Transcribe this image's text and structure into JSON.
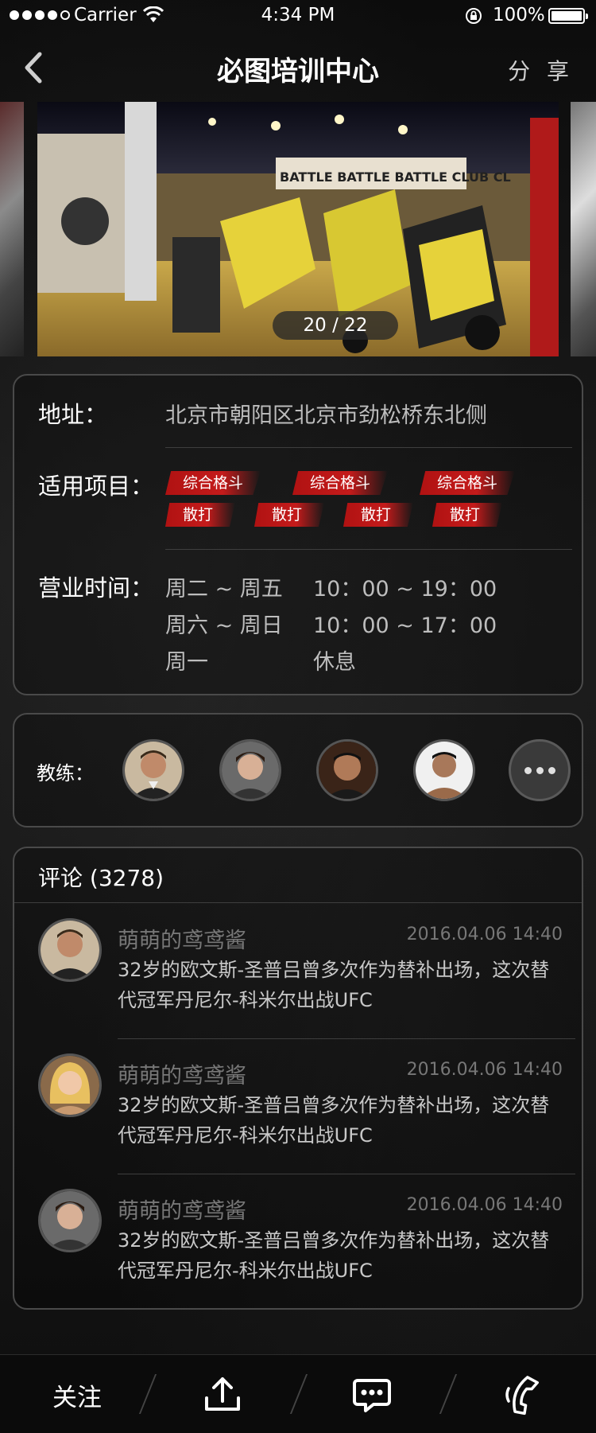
{
  "status_bar": {
    "carrier": "Carrier",
    "time": "4:34 PM",
    "battery_pct": "100%"
  },
  "nav": {
    "title": "必图培训中心",
    "share_label": "分 享"
  },
  "carousel": {
    "counter": "20 / 22",
    "sign_text": "BATTLE BATTLE BATTLE CLUB CL"
  },
  "info": {
    "address_label": "地址：",
    "address_value": "北京市朝阳区北京市劲松桥东北侧",
    "projects_label": "适用项目：",
    "project_tags_row1": [
      "综合格斗",
      "综合格斗",
      "综合格斗"
    ],
    "project_tags_row2": [
      "散打",
      "散打",
      "散打",
      "散打"
    ],
    "hours_label": "营业时间：",
    "hours": [
      {
        "days": "周二 ~ 周五",
        "time": "10：00 ~ 19：00"
      },
      {
        "days": "周六 ~ 周日",
        "time": "10：00 ~ 17：00"
      },
      {
        "days": "周一",
        "time": "休息"
      }
    ]
  },
  "coaches": {
    "label": "教练：",
    "count": 4
  },
  "comments": {
    "header": "评论 (3278)",
    "items": [
      {
        "name": "萌萌的鸢鸢酱",
        "time": "2016.04.06   14:40",
        "text": "32岁的欧文斯-圣普吕曾多次作为替补出场，这次替代冠军丹尼尔-科米尔出战UFC"
      },
      {
        "name": "萌萌的鸢鸢酱",
        "time": "2016.04.06 14:40",
        "text": "32岁的欧文斯-圣普吕曾多次作为替补出场，这次替代冠军丹尼尔-科米尔出战UFC"
      },
      {
        "name": "萌萌的鸢鸢酱",
        "time": "2016.04.06   14:40",
        "text": "32岁的欧文斯-圣普吕曾多次作为替补出场，这次替代冠军丹尼尔-科米尔出战UFC"
      }
    ]
  },
  "bottom_bar": {
    "follow_label": "关注",
    "icons": [
      "share-upload-icon",
      "message-icon",
      "phone-icon"
    ]
  },
  "colors": {
    "tag_red": "#c41b1b",
    "panel_border": "#4a4a4a",
    "background": "#141414"
  }
}
